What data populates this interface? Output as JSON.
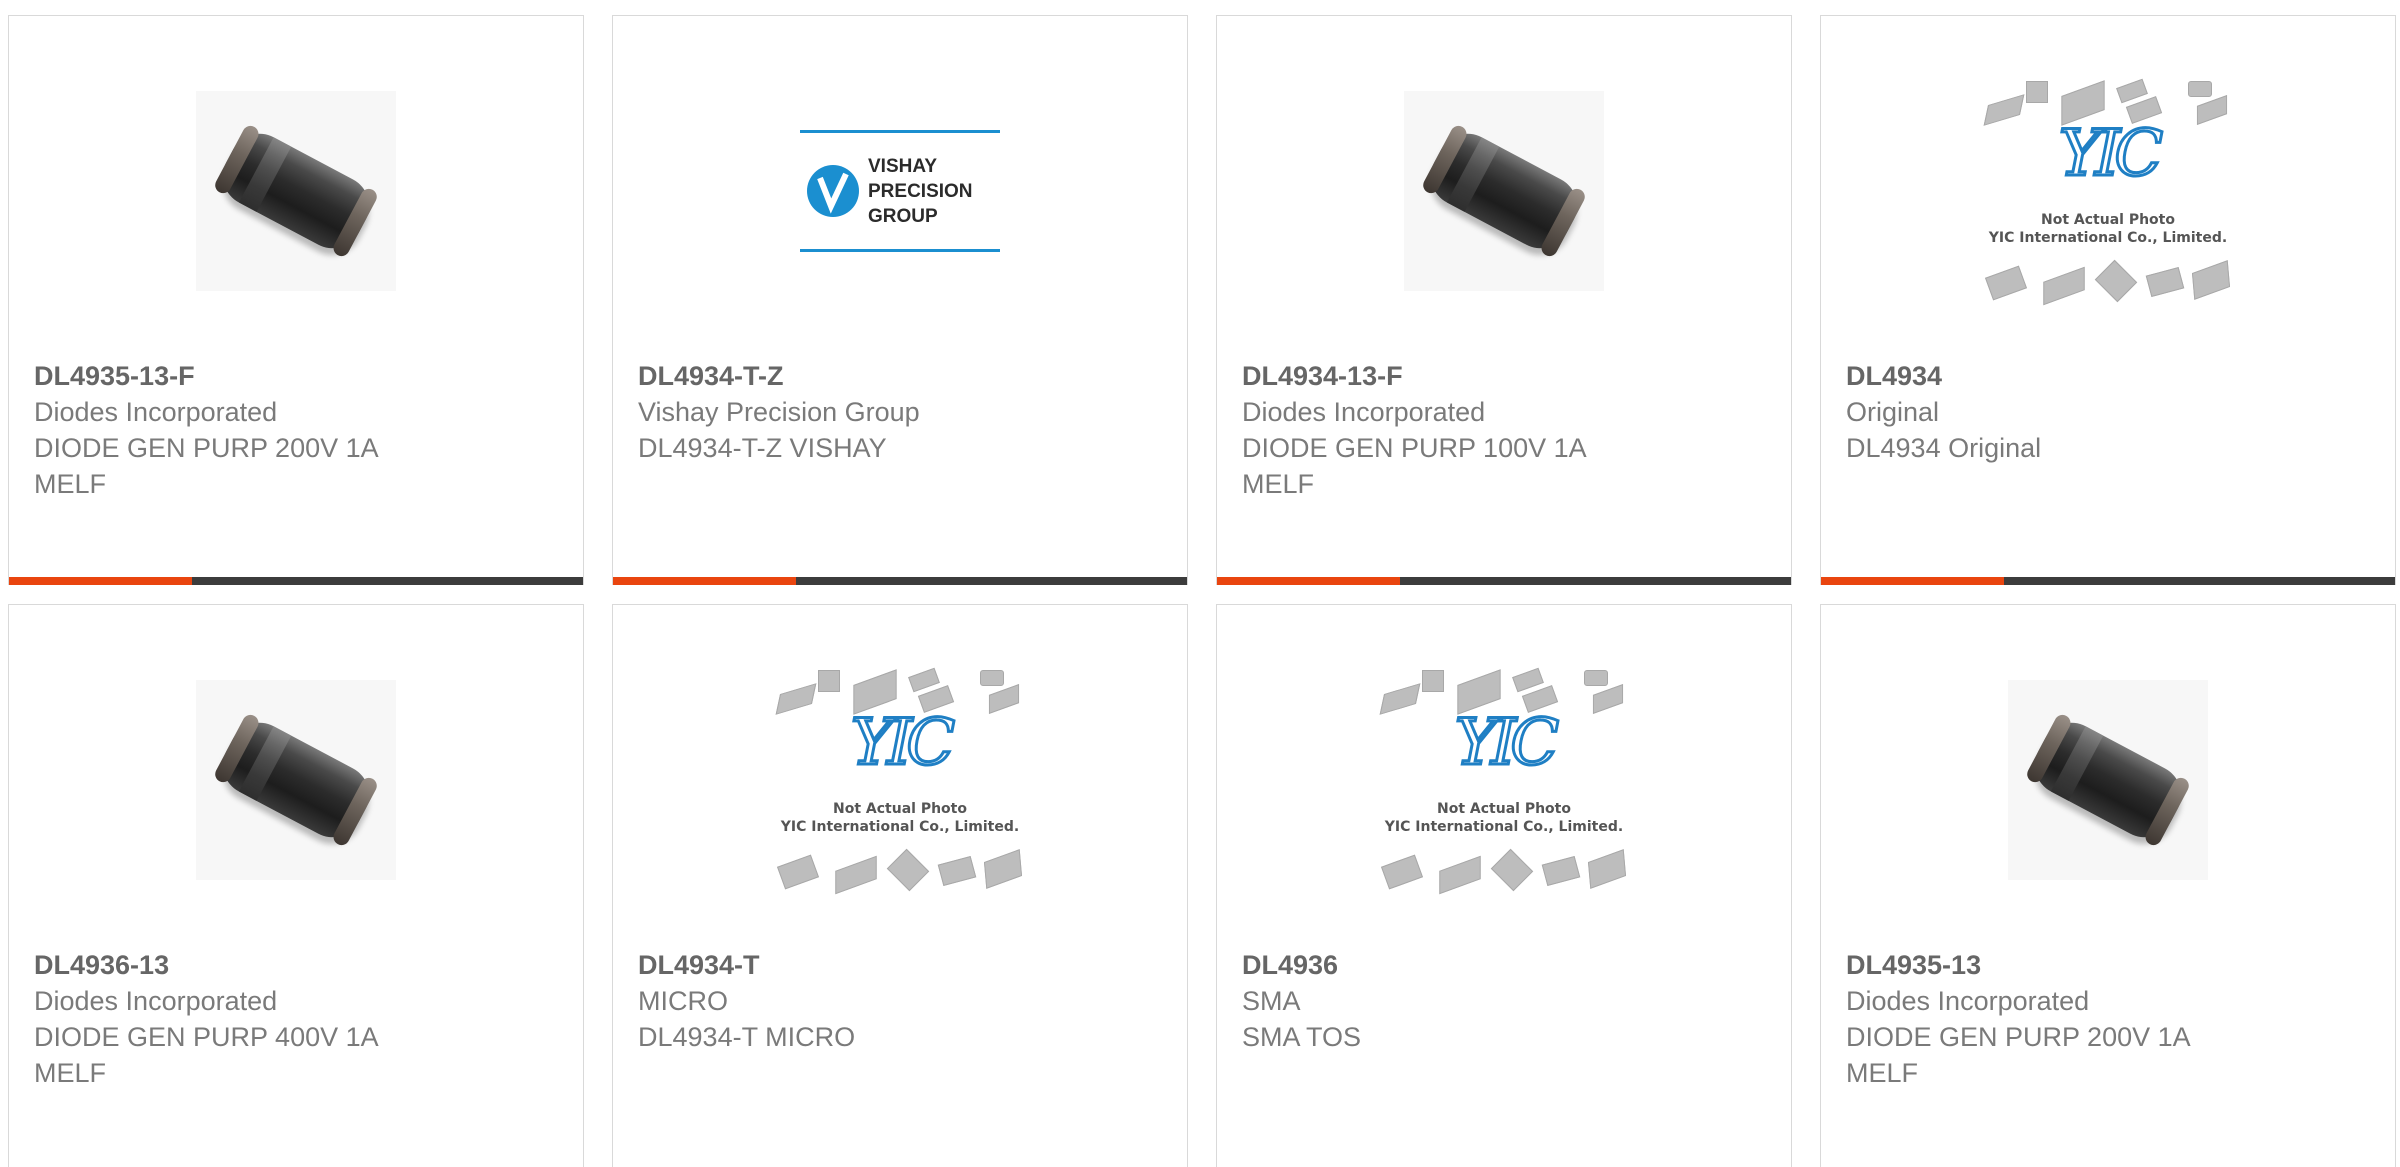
{
  "products": [
    {
      "part": "DL4935-13-F",
      "maker": "Diodes Incorporated",
      "line1": "DIODE GEN PURP 200V 1A",
      "line2": "MELF",
      "image": "diode-photo"
    },
    {
      "part": "DL4934-T-Z",
      "maker": "Vishay Precision Group",
      "line1": "DL4934-T-Z VISHAY",
      "line2": "",
      "image": "vishay-logo"
    },
    {
      "part": "DL4934-13-F",
      "maker": "Diodes Incorporated",
      "line1": "DIODE GEN PURP 100V 1A",
      "line2": "MELF",
      "image": "diode-photo"
    },
    {
      "part": "DL4934",
      "maker": "Original",
      "line1": "DL4934 Original",
      "line2": "",
      "image": "yic-placeholder"
    },
    {
      "part": "DL4936-13",
      "maker": "Diodes Incorporated",
      "line1": "DIODE GEN PURP 400V 1A",
      "line2": "MELF",
      "image": "diode-photo"
    },
    {
      "part": "DL4934-T",
      "maker": "MICRO",
      "line1": "DL4934-T MICRO",
      "line2": "",
      "image": "yic-placeholder"
    },
    {
      "part": "DL4936",
      "maker": "SMA",
      "line1": "SMA TOS",
      "line2": "",
      "image": "yic-placeholder"
    },
    {
      "part": "DL4935-13",
      "maker": "Diodes Incorporated",
      "line1": "DIODE GEN PURP 200V 1A",
      "line2": "MELF",
      "image": "diode-photo"
    }
  ],
  "vishay": {
    "l1": "VISHAY",
    "l2": "PRECISION",
    "l3": "GROUP"
  },
  "yic": {
    "logo": "YIC",
    "note1": "Not Actual Photo",
    "note2": "YIC International Co., Limited."
  },
  "colors": {
    "accent": "#e9450f",
    "bar": "#3c3c3c",
    "vishay_blue": "#1b8fd0",
    "yic_blue": "#1f7fc4"
  }
}
